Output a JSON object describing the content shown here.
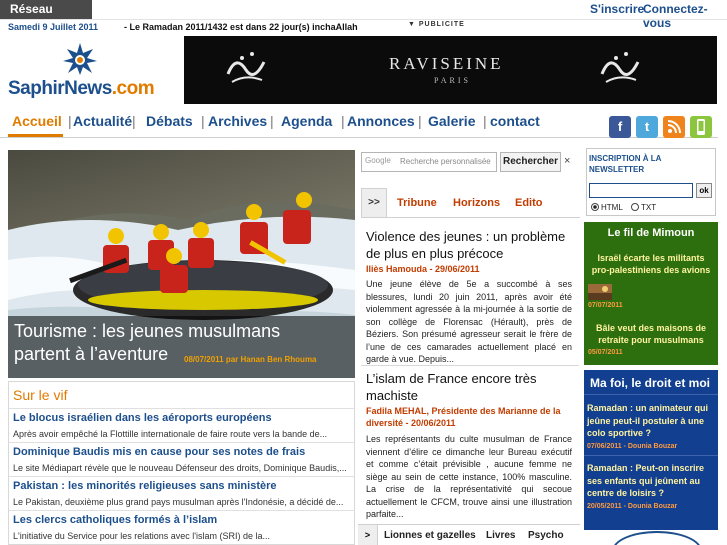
{
  "topbar": {
    "social_menu": "Réseau social",
    "signup": "S'inscrire",
    "login": "Connectez-vous"
  },
  "datebar": {
    "date": "Samedi 9 Juillet 2011",
    "ticker": "- Le Ramadan 2011/1432 est dans 22 jour(s) inchaAllah",
    "pub": "PUBLICITE"
  },
  "logo": {
    "text_main": "SaphirNews",
    "text_tld": ".com"
  },
  "banner": {
    "brand": "RAVISEINE",
    "sub": "PARIS"
  },
  "nav": {
    "items": [
      "Accueil",
      "Actualité",
      "Débats",
      "Archives",
      "Agenda",
      "Annonces",
      "Galerie",
      "contact"
    ],
    "sep": "|"
  },
  "social_icons": [
    "f",
    "t",
    "rss",
    "mobile"
  ],
  "hero": {
    "title": "Tourisme : les jeunes musulmans partent à l’aventure",
    "meta": "08/07/2011 par Hanan Ben Rhouma"
  },
  "vif": {
    "title": "Sur le vif",
    "items": [
      {
        "title": "Le blocus israélien dans les aéroports européens",
        "text": "Après avoir empêché la Flottille internationale de faire route vers la bande de..."
      },
      {
        "title": "Dominique Baudis mis en cause pour ses notes de frais",
        "text": "Le site Médiapart révèle que le nouveau Défenseur des droits, Dominique Baudis,..."
      },
      {
        "title": "Pakistan : les minorités religieuses sans ministère",
        "text": "Le Pakistan, deuxième plus grand pays musulman après l'Indonésie, a décidé de..."
      },
      {
        "title": "Les clercs catholiques formés à l’islam",
        "text": "L'initiative du Service pour les relations avec l'islam (SRI) de la..."
      }
    ]
  },
  "search": {
    "google": "Google",
    "placeholder": "Recherche personnalisée",
    "button": "Rechercher",
    "close": "×"
  },
  "tabs": {
    "arrow": ">>",
    "items": [
      "Tribune",
      "Horizons",
      "Edito"
    ]
  },
  "articles": [
    {
      "title": "Violence des jeunes : un problème de plus en plus précoce",
      "author": "Iliès Hamouda - 29/06/2011",
      "text": "Une jeune élève de 5e a succombé à ses blessures, lundi 20 juin 2011, après avoir été violemment agressée à la mi-journée à la sortie de son collège de Florensac (Hérault), près de Béziers. Son présumé agresseur serait le frère de l’une de ces camarades actuellement placé en garde à vue. Depuis..."
    },
    {
      "title": "L’islam de France encore très machiste",
      "author": "Fadila MEHAL, Présidente des Marianne de la diversité - 20/06/2011",
      "text": "Les représentants du culte musulman de France viennent d’élire ce dimanche leur Bureau exécutif et comme c’était prévisible , aucune femme ne siège au sein de cette instance, 100% masculine. La crise de la représentativité qui secoue actuellement le CFCM, trouve ainsi une illustration parfaite..."
    }
  ],
  "tabs2": {
    "arrow": ">",
    "items": [
      "Lionnes et gazelles",
      "Livres",
      "Psycho"
    ]
  },
  "newsletter": {
    "title": "INSCRIPTION À LA NEWSLETTER",
    "ok": "ok",
    "html": "HTML",
    "txt": "TXT"
  },
  "mimoun": {
    "title": "Le fil de Mimoun",
    "items": [
      {
        "text": "Israël écarte les militants pro-palestiniens des avions",
        "date": "07/07/2011"
      },
      {
        "text": "Bâle veut des maisons de retraite pour musulmans",
        "date": "05/07/2011"
      }
    ]
  },
  "mafoi": {
    "title": "Ma foi, le droit et moi",
    "items": [
      {
        "text": "Ramadan : un animateur qui jeûne peut-il postuler à une colo sportive ?",
        "date": "07/06/2011 - Dounia Bouzar"
      },
      {
        "text": "Ramadan : Peut-on inscrire ses enfants qui jeûnent au centre de loisirs ?",
        "date": "20/05/2011 - Dounia Bouzar"
      }
    ]
  },
  "colors": {
    "brand_blue": "#1c4f8c",
    "accent_orange": "#e07b00",
    "mimoun_green": "#2d6e0f",
    "mafoi_blue": "#123f8f",
    "author_red": "#c13c00"
  }
}
